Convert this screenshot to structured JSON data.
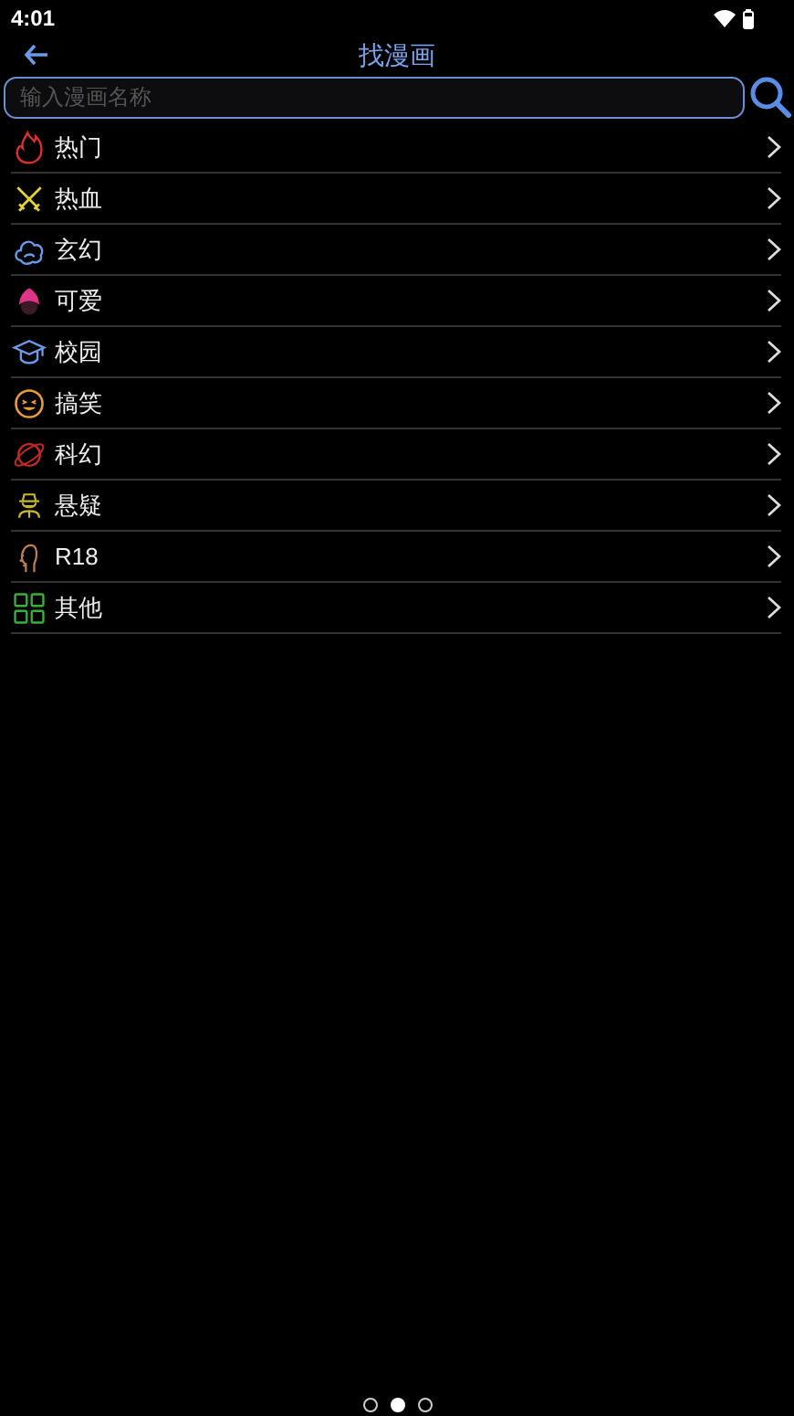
{
  "status_bar": {
    "time": "4:01"
  },
  "header": {
    "title": "找漫画"
  },
  "search": {
    "placeholder": "输入漫画名称"
  },
  "categories": [
    {
      "label": "热门",
      "kind": "flame"
    },
    {
      "label": "热血",
      "kind": "swords"
    },
    {
      "label": "玄幻",
      "kind": "cloud"
    },
    {
      "label": "可爱",
      "kind": "cute"
    },
    {
      "label": "校园",
      "kind": "cap"
    },
    {
      "label": "搞笑",
      "kind": "smile"
    },
    {
      "label": "科幻",
      "kind": "planet"
    },
    {
      "label": "悬疑",
      "kind": "detective"
    },
    {
      "label": "R18",
      "kind": "adult"
    },
    {
      "label": "其他",
      "kind": "grid"
    }
  ],
  "pager": [
    {
      "selected": false
    },
    {
      "selected": true
    },
    {
      "selected": false
    }
  ]
}
